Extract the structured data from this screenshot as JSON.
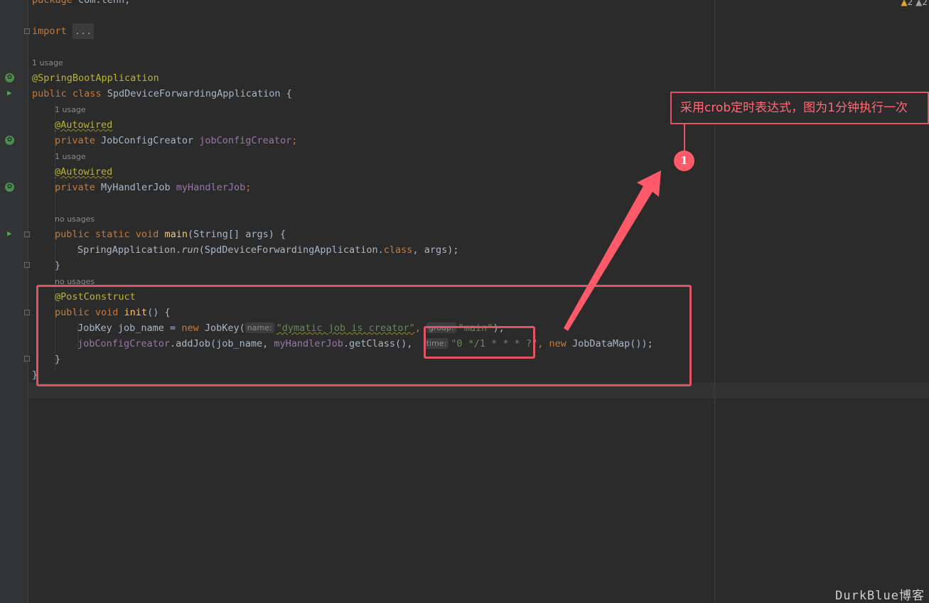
{
  "editor": {
    "inspections": {
      "warnings": "2",
      "weak_warnings": "2"
    },
    "lines": {
      "package": {
        "kw": "package",
        "name": "com.tenn;"
      },
      "import": {
        "kw": "import",
        "fold": "..."
      },
      "usage_class": "1 usage",
      "app_annotation": "@SpringBootApplication",
      "class_decl": {
        "kw": "public class",
        "name": "SpdDeviceForwardingApplication",
        "brace": "{"
      },
      "usage_field1": "1 usage",
      "autowired1": "@Autowired",
      "field1": {
        "kw": "private",
        "type": "JobConfigCreator",
        "name": "jobConfigCreator",
        "end": ";"
      },
      "usage_field2": "1 usage",
      "autowired2": "@Autowired",
      "field2": {
        "kw": "private",
        "type": "MyHandlerJob",
        "name": "myHandlerJob",
        "end": ";"
      },
      "usage_main": "no usages",
      "main_decl": {
        "kw": "public static void",
        "name": "main",
        "params": "(String[] args) {"
      },
      "main_body": {
        "cls": "SpringApplication.",
        "method": "run",
        "open": "(SpdDeviceForwardingApplication.",
        "kw": "class",
        "rest": ", args);"
      },
      "close_main": "}",
      "usage_init": "no usages",
      "post_construct": "@PostConstruct",
      "init_decl": {
        "kw": "public void",
        "name": "init",
        "params": "() {"
      },
      "jobkey_line": {
        "decl": "JobKey job_name = ",
        "kw_new": "new",
        "ctor": " JobKey(",
        "hint_name": "name:",
        "str1": "\"dymatic job is creator\"",
        "comma": ",",
        "hint_group": "group:",
        "str2": "\"main\"",
        "end": ");"
      },
      "addjob_line": {
        "obj": "jobConfigCreator",
        "call": ".addJob(job_name, ",
        "field": "myHandlerJob",
        "rest": ".getClass(),",
        "hint_time": "time:",
        "cron": "\"0 */1 * * * ?\"",
        "comma": ",",
        "kw_new": "new",
        "tail": " JobDataMap());"
      },
      "close_init": "}",
      "close_class": "}"
    }
  },
  "annotation": {
    "callout_text": "采用crob定时表达式，图为1分钟执行一次",
    "badge_number": "1",
    "accent_color": "#e05561"
  },
  "watermark": "DurkBlue博客"
}
